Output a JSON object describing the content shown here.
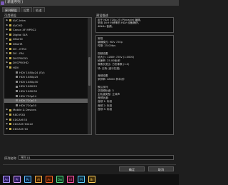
{
  "window": {
    "title": "[ 新建序列 ]"
  },
  "tabs": [
    {
      "label": "序列预设"
    },
    {
      "label": "设置"
    },
    {
      "label": "轨道"
    }
  ],
  "left_panel": {
    "label": "可用预设"
  },
  "right_panel": {
    "label": "预设描述"
  },
  "tree": [
    {
      "label": "AVC-Intra",
      "expander": "▶",
      "depth": 0,
      "folder": true
    },
    {
      "label": "AVCHD",
      "expander": "▶",
      "depth": 0,
      "folder": true
    },
    {
      "label": "Canon XF MPEG2",
      "expander": "▶",
      "depth": 0,
      "folder": true
    },
    {
      "label": "Digital SLR",
      "expander": "▶",
      "depth": 0,
      "folder": true
    },
    {
      "label": "DNxHD",
      "expander": "▶",
      "depth": 0,
      "folder": true
    },
    {
      "label": "DNxHR",
      "expander": "▶",
      "depth": 0,
      "folder": true
    },
    {
      "label": "DV - NTSC",
      "expander": "▶",
      "depth": 0,
      "folder": true
    },
    {
      "label": "DV - PAL",
      "expander": "▶",
      "depth": 0,
      "folder": true
    },
    {
      "label": "DVCPRO50",
      "expander": "▶",
      "depth": 0,
      "folder": true
    },
    {
      "label": "DVCPROHD",
      "expander": "▶",
      "depth": 0,
      "folder": true
    },
    {
      "label": "HDV",
      "expander": "▼",
      "depth": 0,
      "folder": true
    },
    {
      "label": "HDV 1080p24 (SV)",
      "expander": "",
      "depth": 1,
      "folder": false
    },
    {
      "label": "HDV 1080p25",
      "expander": "",
      "depth": 1,
      "folder": false
    },
    {
      "label": "HDV 1080p30",
      "expander": "",
      "depth": 1,
      "folder": false
    },
    {
      "label": "HDV 1080i25",
      "expander": "",
      "depth": 1,
      "folder": false
    },
    {
      "label": "HDV 1080i30",
      "expander": "",
      "depth": 1,
      "folder": false
    },
    {
      "label": "HDV 720p24",
      "expander": "",
      "depth": 1,
      "folder": false
    },
    {
      "label": "HDV 720p25",
      "expander": "",
      "depth": 1,
      "folder": false
    },
    {
      "label": "HDV 720p30",
      "expander": "",
      "depth": 1,
      "folder": false
    },
    {
      "label": "Mobile & Devices",
      "expander": "▶",
      "depth": 0,
      "folder": true
    },
    {
      "label": "RED R3D",
      "expander": "▶",
      "depth": 0,
      "folder": true
    },
    {
      "label": "XDCAM EX",
      "expander": "▶",
      "depth": 0,
      "folder": true
    },
    {
      "label": "XDCAM HD422",
      "expander": "▶",
      "depth": 0,
      "folder": true
    },
    {
      "label": "XDCAM HD",
      "expander": "▶",
      "depth": 0,
      "folder": true
    }
  ],
  "selected_index": 17,
  "description": {
    "lines": [
      "用于 HDV 720p 25 (Pinnacle) 编辑，",
      "采用 16:9 分辨率的 HDV 设备捕获，",
      "48kHz 音频。"
    ]
  },
  "details": {
    "lines": [
      "常规",
      "编辑模式: HDV 720p",
      "时基: 25.00fps",
      "",
      "视频设置",
      "帧大小: 1280h 720v (1.0000)",
      "帧速率: 25.00帧/秒",
      "像素长宽比: 方形像素 (1.0)",
      "场: 无场 (逐行扫描)",
      "",
      "音频设置",
      "采样率: 48000 样本/秒",
      "",
      "默认序列",
      "总视频轨道: 3",
      "主轨道类型: 立体声",
      "音频轨道:",
      "音频 1: 标准",
      "音频 2: 标准",
      "音频 3: 标准"
    ]
  },
  "preset_name": {
    "label": "序列名称",
    "value": "序列 01"
  },
  "buttons": {
    "ok": "确定",
    "cancel": "取消"
  },
  "taskbar": [
    {
      "name": "after-effects-icon",
      "text": "Ae",
      "color": "#2a1a5e",
      "fg": "#b59cff"
    },
    {
      "name": "premiere-icon",
      "text": "Pr",
      "color": "#2a1a5e",
      "fg": "#e0a8ff"
    },
    {
      "name": "photoshop-icon",
      "text": "Ps",
      "color": "#0a2340",
      "fg": "#5fbfff"
    },
    {
      "name": "illustrator-icon",
      "text": "Ai",
      "color": "#3a1f00",
      "fg": "#ffb54a"
    },
    {
      "name": "animate-icon",
      "text": "An",
      "color": "#3a1400",
      "fg": "#ff6a2a"
    },
    {
      "name": "dreamweaver-icon",
      "text": "Dw",
      "color": "#0a3a20",
      "fg": "#5fe08a"
    },
    {
      "name": "indesign-icon",
      "text": "Id",
      "color": "#3a0a20",
      "fg": "#ff5ca8"
    },
    {
      "name": "prelude-icon",
      "text": "Pl",
      "color": "#0a2a3a",
      "fg": "#5fd0ff"
    },
    {
      "name": "bridge-icon",
      "text": "Br",
      "color": "#3a2a0a",
      "fg": "#ffcf5a"
    }
  ]
}
